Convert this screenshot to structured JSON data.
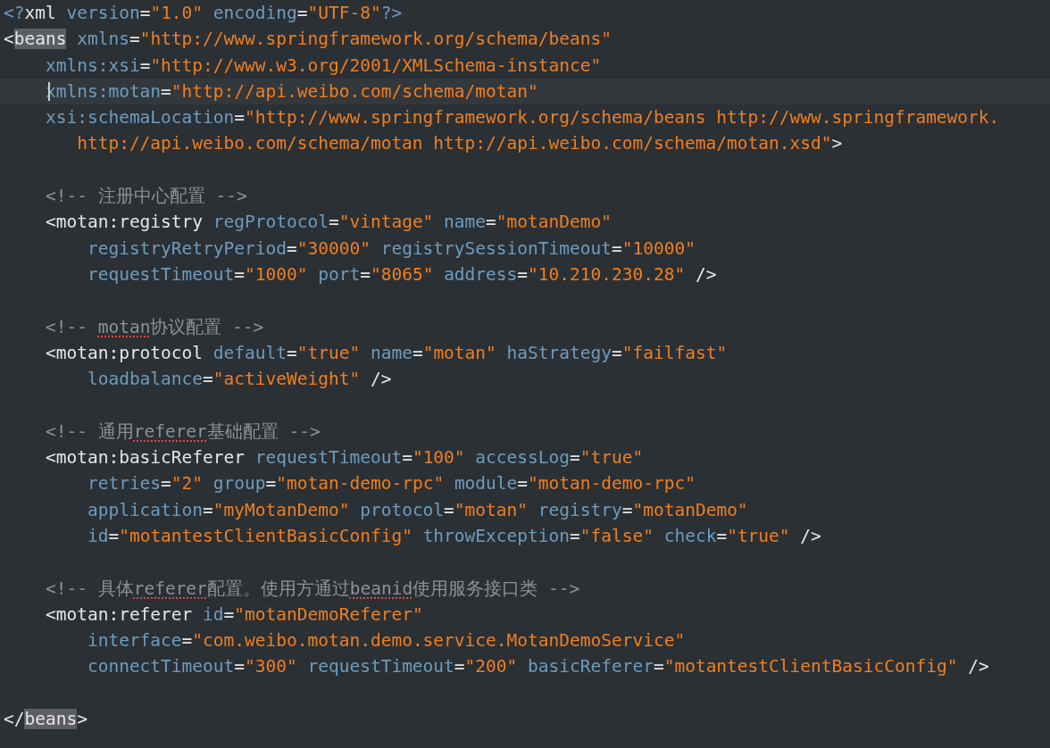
{
  "editor": {
    "lines": [
      {
        "current": false,
        "tokens": [
          {
            "kind": "decl",
            "text": "<?"
          },
          {
            "kind": "tag",
            "text": "xml"
          },
          {
            "kind": "attr",
            "text": " version"
          },
          {
            "kind": "eq",
            "text": "="
          },
          {
            "kind": "value",
            "text": "\"1.0\""
          },
          {
            "kind": "attr",
            "text": " encoding"
          },
          {
            "kind": "eq",
            "text": "="
          },
          {
            "kind": "value",
            "text": "\"UTF-8\""
          },
          {
            "kind": "decl",
            "text": "?>"
          }
        ]
      },
      {
        "current": false,
        "tokens": [
          {
            "kind": "tag",
            "text": "<"
          },
          {
            "kind": "match",
            "text": "beans"
          },
          {
            "kind": "attr",
            "text": " xmlns"
          },
          {
            "kind": "eq",
            "text": "="
          },
          {
            "kind": "value",
            "text": "\"http://www.springframework.org/schema/beans\""
          }
        ]
      },
      {
        "current": false,
        "tokens": [
          {
            "kind": "attr",
            "text": "    xmlns:xsi"
          },
          {
            "kind": "eq",
            "text": "="
          },
          {
            "kind": "value",
            "text": "\"http://www.w3.org/2001/XMLSchema-instance\""
          }
        ]
      },
      {
        "current": true,
        "tokens": [
          {
            "kind": "attr",
            "text": "    xmlns:motan"
          },
          {
            "kind": "eq",
            "text": "="
          },
          {
            "kind": "value",
            "text": "\"http://api.weibo.com/schema/motan\""
          }
        ]
      },
      {
        "current": false,
        "tokens": [
          {
            "kind": "attr",
            "text": "    xsi:schemaLocation"
          },
          {
            "kind": "eq",
            "text": "="
          },
          {
            "kind": "value",
            "text": "\"http://www.springframework.org/schema/beans http://www.springframework."
          }
        ]
      },
      {
        "current": false,
        "tokens": [
          {
            "kind": "value",
            "text": "       http://api.weibo.com/schema/motan http://api.weibo.com/schema/motan.xsd\""
          },
          {
            "kind": "tag",
            "text": ">"
          }
        ]
      },
      {
        "current": false
      },
      {
        "current": false,
        "tokens": [
          {
            "kind": "comment",
            "text": "    <!-- 注册中心配置 -->"
          }
        ]
      },
      {
        "current": false,
        "tokens": [
          {
            "kind": "tag",
            "text": "    <motan:registry"
          },
          {
            "kind": "attr",
            "text": " regProtocol"
          },
          {
            "kind": "eq",
            "text": "="
          },
          {
            "kind": "value",
            "text": "\"vintage\""
          },
          {
            "kind": "attr",
            "text": " name"
          },
          {
            "kind": "eq",
            "text": "="
          },
          {
            "kind": "value",
            "text": "\"motanDemo\""
          }
        ]
      },
      {
        "current": false,
        "tokens": [
          {
            "kind": "attr",
            "text": "        registryRetryPeriod"
          },
          {
            "kind": "eq",
            "text": "="
          },
          {
            "kind": "value",
            "text": "\"30000\""
          },
          {
            "kind": "attr",
            "text": " registrySessionTimeout"
          },
          {
            "kind": "eq",
            "text": "="
          },
          {
            "kind": "value",
            "text": "\"10000\""
          }
        ]
      },
      {
        "current": false,
        "tokens": [
          {
            "kind": "attr",
            "text": "        requestTimeout"
          },
          {
            "kind": "eq",
            "text": "="
          },
          {
            "kind": "value",
            "text": "\"1000\""
          },
          {
            "kind": "attr",
            "text": " port"
          },
          {
            "kind": "eq",
            "text": "="
          },
          {
            "kind": "value",
            "text": "\"8065\""
          },
          {
            "kind": "attr",
            "text": " address"
          },
          {
            "kind": "eq",
            "text": "="
          },
          {
            "kind": "value",
            "text": "\"10.210.230.28\""
          },
          {
            "kind": "tag",
            "text": " />"
          }
        ]
      },
      {
        "current": false
      },
      {
        "current": false,
        "tokens": [
          {
            "kind": "comment",
            "text": "    <!-- "
          },
          {
            "kind": "misspelled",
            "text": "motan"
          },
          {
            "kind": "comment",
            "text": "协议配置 -->"
          }
        ]
      },
      {
        "current": false,
        "tokens": [
          {
            "kind": "tag",
            "text": "    <motan:protocol"
          },
          {
            "kind": "attr",
            "text": " default"
          },
          {
            "kind": "eq",
            "text": "="
          },
          {
            "kind": "value",
            "text": "\"true\""
          },
          {
            "kind": "attr",
            "text": " name"
          },
          {
            "kind": "eq",
            "text": "="
          },
          {
            "kind": "value",
            "text": "\"motan\""
          },
          {
            "kind": "attr",
            "text": " haStrategy"
          },
          {
            "kind": "eq",
            "text": "="
          },
          {
            "kind": "value",
            "text": "\"failfast\""
          }
        ]
      },
      {
        "current": false,
        "tokens": [
          {
            "kind": "attr",
            "text": "        loadbalance"
          },
          {
            "kind": "eq",
            "text": "="
          },
          {
            "kind": "value",
            "text": "\"activeWeight\""
          },
          {
            "kind": "tag",
            "text": " />"
          }
        ]
      },
      {
        "current": false
      },
      {
        "current": false,
        "tokens": [
          {
            "kind": "comment",
            "text": "    <!-- 通用"
          },
          {
            "kind": "misspelled",
            "text": "referer"
          },
          {
            "kind": "comment",
            "text": "基础配置 -->"
          }
        ]
      },
      {
        "current": false,
        "tokens": [
          {
            "kind": "tag",
            "text": "    <motan:basicReferer"
          },
          {
            "kind": "attr",
            "text": " requestTimeout"
          },
          {
            "kind": "eq",
            "text": "="
          },
          {
            "kind": "value",
            "text": "\"100\""
          },
          {
            "kind": "attr",
            "text": " accessLog"
          },
          {
            "kind": "eq",
            "text": "="
          },
          {
            "kind": "value",
            "text": "\"true\""
          }
        ]
      },
      {
        "current": false,
        "tokens": [
          {
            "kind": "attr",
            "text": "        retries"
          },
          {
            "kind": "eq",
            "text": "="
          },
          {
            "kind": "value",
            "text": "\"2\""
          },
          {
            "kind": "attr",
            "text": " group"
          },
          {
            "kind": "eq",
            "text": "="
          },
          {
            "kind": "value",
            "text": "\"motan-demo-rpc\""
          },
          {
            "kind": "attr",
            "text": " module"
          },
          {
            "kind": "eq",
            "text": "="
          },
          {
            "kind": "value",
            "text": "\"motan-demo-rpc\""
          }
        ]
      },
      {
        "current": false,
        "tokens": [
          {
            "kind": "attr",
            "text": "        application"
          },
          {
            "kind": "eq",
            "text": "="
          },
          {
            "kind": "value",
            "text": "\"myMotanDemo\""
          },
          {
            "kind": "attr",
            "text": " protocol"
          },
          {
            "kind": "eq",
            "text": "="
          },
          {
            "kind": "value",
            "text": "\"motan\""
          },
          {
            "kind": "attr",
            "text": " registry"
          },
          {
            "kind": "eq",
            "text": "="
          },
          {
            "kind": "value",
            "text": "\"motanDemo\""
          }
        ]
      },
      {
        "current": false,
        "tokens": [
          {
            "kind": "attr",
            "text": "        id"
          },
          {
            "kind": "eq",
            "text": "="
          },
          {
            "kind": "value",
            "text": "\"motantestClientBasicConfig\""
          },
          {
            "kind": "attr",
            "text": " throwException"
          },
          {
            "kind": "eq",
            "text": "="
          },
          {
            "kind": "value",
            "text": "\"false\""
          },
          {
            "kind": "attr",
            "text": " check"
          },
          {
            "kind": "eq",
            "text": "="
          },
          {
            "kind": "value",
            "text": "\"true\""
          },
          {
            "kind": "tag",
            "text": " />"
          }
        ]
      },
      {
        "current": false
      },
      {
        "current": false,
        "tokens": [
          {
            "kind": "comment",
            "text": "    <!-- 具体"
          },
          {
            "kind": "misspelled",
            "text": "referer"
          },
          {
            "kind": "comment",
            "text": "配置。使用方通过"
          },
          {
            "kind": "misspelled",
            "text": "beanid"
          },
          {
            "kind": "comment",
            "text": "使用服务接口类 -->"
          }
        ]
      },
      {
        "current": false,
        "tokens": [
          {
            "kind": "tag",
            "text": "    <motan:referer"
          },
          {
            "kind": "attr",
            "text": " id"
          },
          {
            "kind": "eq",
            "text": "="
          },
          {
            "kind": "value",
            "text": "\"motanDemoReferer\""
          }
        ]
      },
      {
        "current": false,
        "tokens": [
          {
            "kind": "attr",
            "text": "        interface"
          },
          {
            "kind": "eq",
            "text": "="
          },
          {
            "kind": "value",
            "text": "\"com.weibo.motan.demo.service.MotanDemoService\""
          }
        ]
      },
      {
        "current": false,
        "tokens": [
          {
            "kind": "attr",
            "text": "        connectTimeout"
          },
          {
            "kind": "eq",
            "text": "="
          },
          {
            "kind": "value",
            "text": "\"300\""
          },
          {
            "kind": "attr",
            "text": " requestTimeout"
          },
          {
            "kind": "eq",
            "text": "="
          },
          {
            "kind": "value",
            "text": "\"200\""
          },
          {
            "kind": "attr",
            "text": " basicReferer"
          },
          {
            "kind": "eq",
            "text": "="
          },
          {
            "kind": "value",
            "text": "\"motantestClientBasicConfig\""
          },
          {
            "kind": "tag",
            "text": " />"
          }
        ]
      },
      {
        "current": false
      },
      {
        "current": false,
        "tokens": [
          {
            "kind": "tag",
            "text": "</"
          },
          {
            "kind": "match",
            "text": "beans"
          },
          {
            "kind": "tag",
            "text": ">"
          }
        ]
      }
    ]
  }
}
